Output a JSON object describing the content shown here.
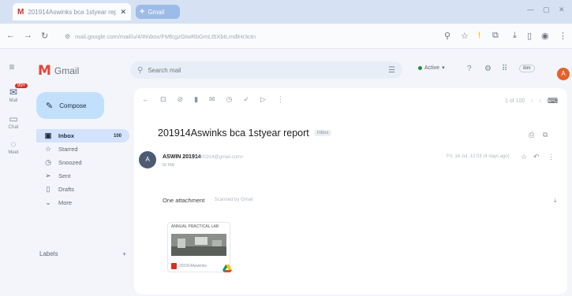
{
  "browser": {
    "tab_title": "201914Aswinks bca 1styear report",
    "newtab_label": "Gmail",
    "url": "mail.google.com/mail/u/4/#inbox/FMfcgzGtwRbGmLt5XbtLmdlHr3ctn"
  },
  "rail": {
    "mail_badge": "99+",
    "items": [
      {
        "label": "Mail"
      },
      {
        "label": "Chat"
      },
      {
        "label": "Meet"
      }
    ]
  },
  "header": {
    "logo_text": "Gmail",
    "search_placeholder": "Search mail",
    "status_label": "Active",
    "brand_label": "ibm",
    "avatar_initial": "A"
  },
  "sidebar": {
    "compose_label": "Compose",
    "items": [
      {
        "label": "Inbox",
        "count": "100",
        "icon": "inbox-icon",
        "active": true
      },
      {
        "label": "Starred",
        "count": "",
        "icon": "star-icon",
        "active": false
      },
      {
        "label": "Snoozed",
        "count": "",
        "icon": "clock-icon",
        "active": false
      },
      {
        "label": "Sent",
        "count": "",
        "icon": "send-icon",
        "active": false
      },
      {
        "label": "Drafts",
        "count": "",
        "icon": "draft-icon",
        "active": false
      },
      {
        "label": "More",
        "count": "",
        "icon": "chevron-down-icon",
        "active": false
      }
    ],
    "labels_heading": "Labels",
    "labels_add": "+"
  },
  "message": {
    "subject": "201914Aswinks bca 1styear report",
    "subject_tag": "Inbox",
    "sender_name": "ASWIN 201914",
    "sender_email": "<201914@gmail.com>",
    "to_line": "to me",
    "timestamp": "Fri, 14 Jul, 12:03 (4 days ago)",
    "pager_text": "1 of 100",
    "attachments_heading": "One attachment",
    "attachments_scan": "· Scanned by Gmail",
    "attachment_caption": "ANNUAL PRACTICAL LAB",
    "attachment_file": "201914Aswinks"
  }
}
